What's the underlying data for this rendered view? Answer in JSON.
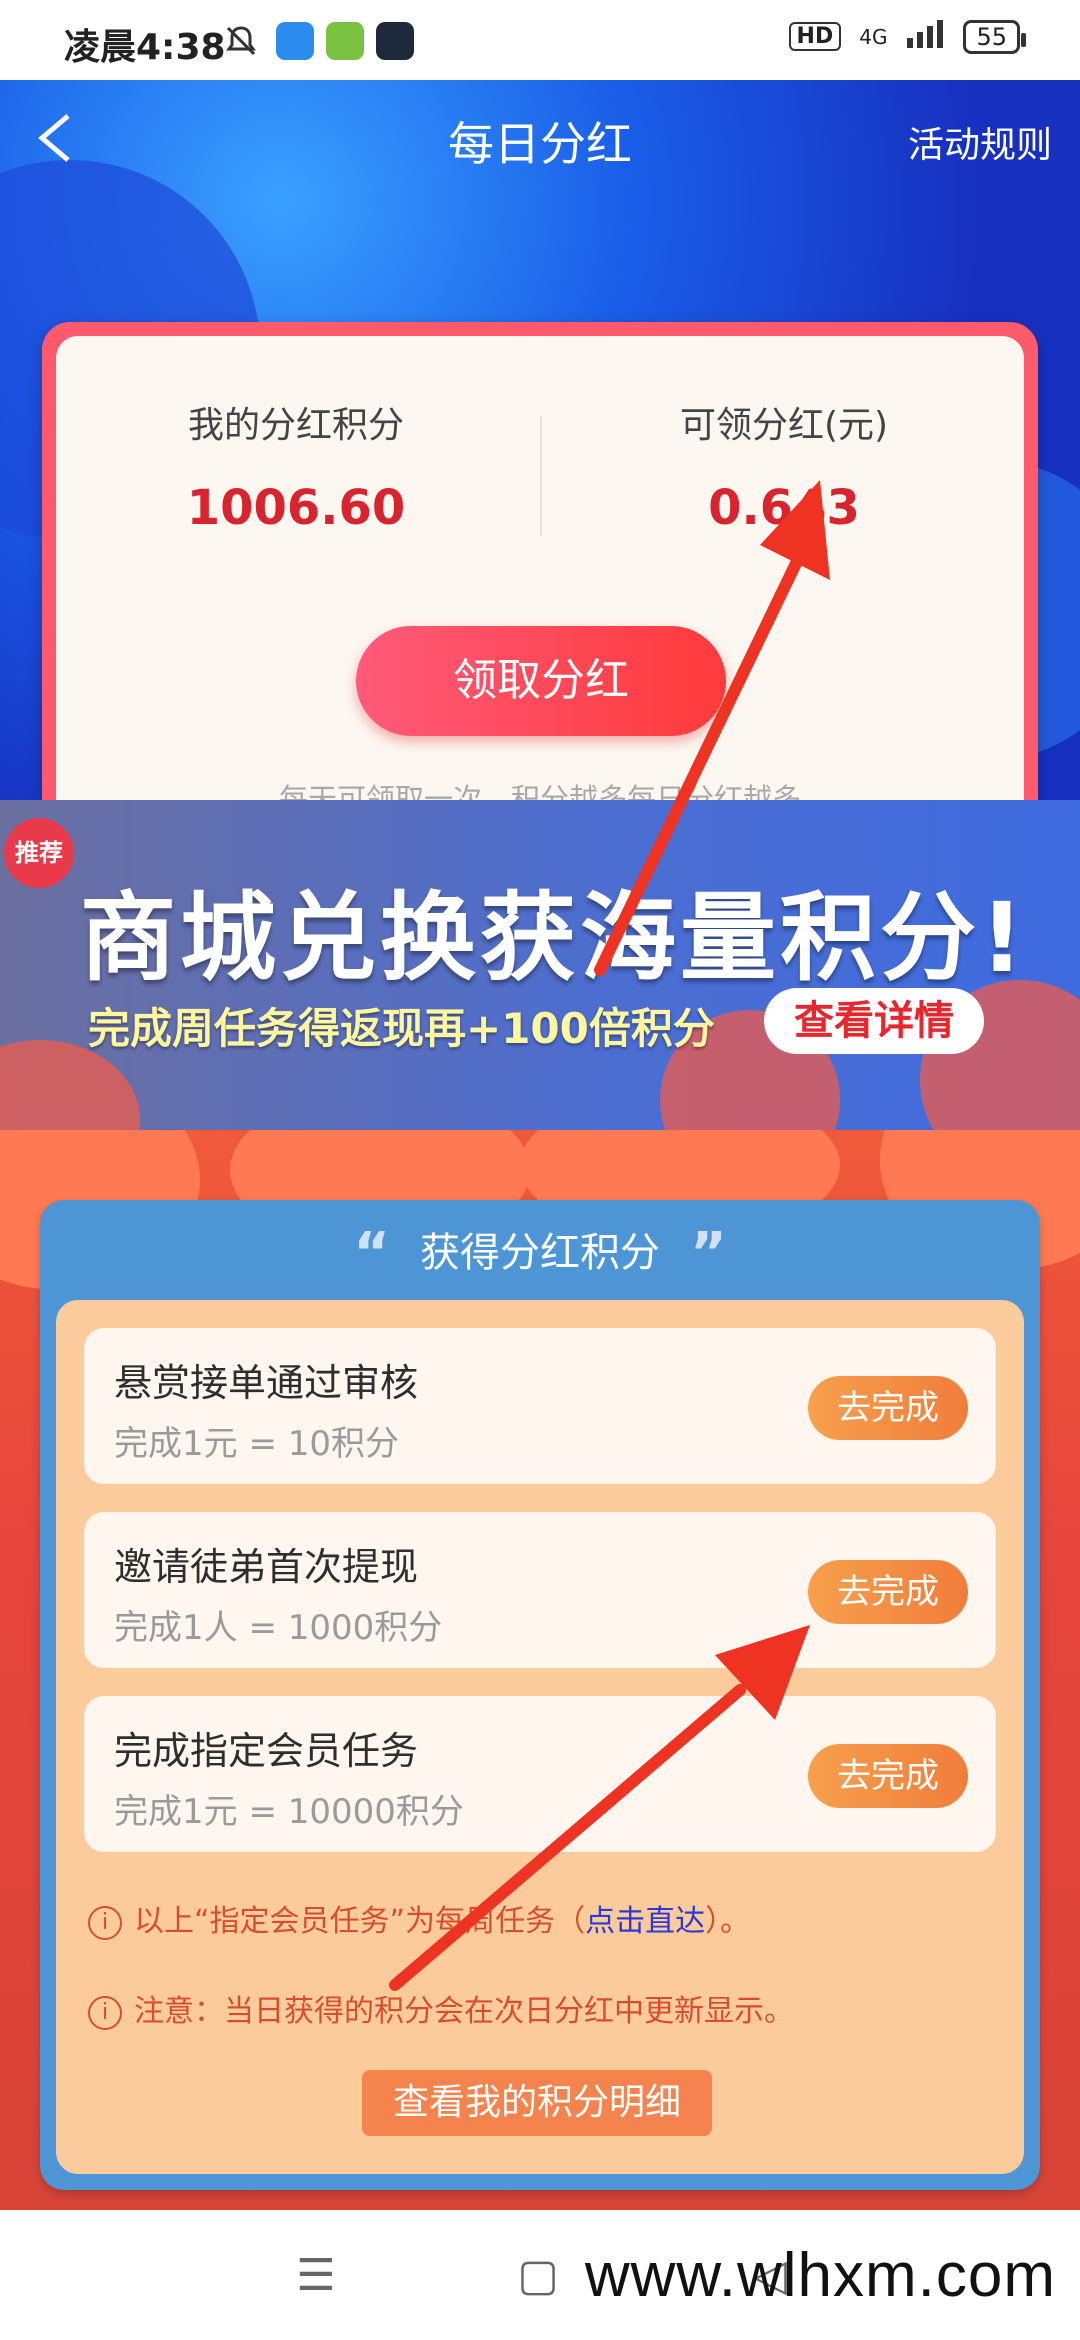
{
  "status_bar": {
    "time": "凌晨4:38",
    "hd": "HD",
    "network": "4G",
    "battery": "55"
  },
  "header": {
    "back_icon": "chevron-left-icon",
    "title": "每日分红",
    "rules_link": "活动规则"
  },
  "dividend_card": {
    "points_label": "我的分红积分",
    "points_value": "1006.60",
    "claimable_label": "可领分红(元)",
    "claimable_value": "0.643",
    "claim_button": "领取分红",
    "note": "每天可领取一次，积分越多每日分红越多"
  },
  "banner": {
    "tag": "推荐",
    "headline": "商城兑换获海量积分!",
    "subline": "完成周任务得返现再+100倍积分",
    "button": "查看详情"
  },
  "points_panel": {
    "title": "获得分红积分",
    "tasks": [
      {
        "name": "悬赏接单通过审核",
        "desc": "完成1元 = 10积分",
        "button": "去完成"
      },
      {
        "name": "邀请徒弟首次提现",
        "desc": "完成1人 = 1000积分",
        "button": "去完成"
      },
      {
        "name": "完成指定会员任务",
        "desc": "完成1元 = 10000积分",
        "button": "去完成"
      }
    ],
    "notice1_prefix": "以上“指定会员任务”为每周任务（",
    "notice1_link": "点击直达",
    "notice1_suffix": "）。",
    "notice2": "注意：当日获得的积分会在次日分红中更新显示。",
    "detail_button": "查看我的积分明细"
  },
  "bottom_nav": {
    "menu_icon": "menu-icon",
    "home_icon": "home-icon",
    "back_icon": "back-icon"
  },
  "watermark": "www.wlhxm.com",
  "colors": {
    "accent_red": "#d8242e",
    "header_blue": "#1730c0",
    "panel_blue": "#4e95d6",
    "panel_peach": "#fccb9b",
    "task_button": "#f07d3b",
    "annotation_arrow": "#ee3322"
  }
}
